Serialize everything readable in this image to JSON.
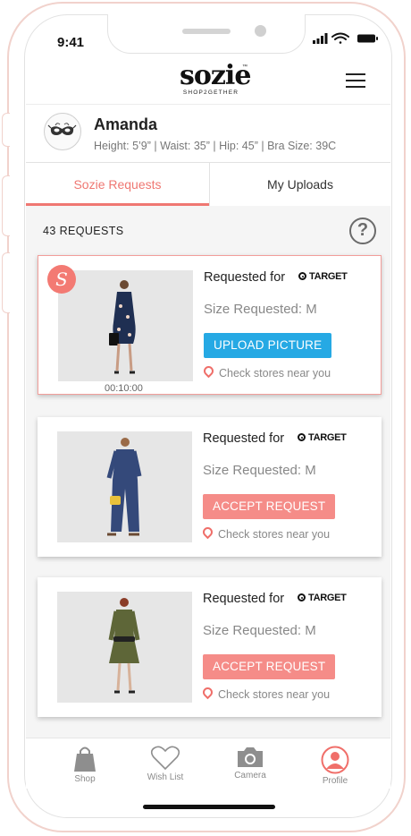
{
  "status_bar": {
    "time": "9:41"
  },
  "header": {
    "logo_main": "sozie",
    "logo_tm": "™",
    "logo_sub": "SHOP2GETHER",
    "menu_icon": "hamburger-menu-icon"
  },
  "profile": {
    "name": "Amanda",
    "stats": "Height: 5’9”  |  Waist: 35”  |  Hip: 45”  |  Bra Size: 39C",
    "avatar_icon": "masquerade-mask-icon"
  },
  "tabs": [
    {
      "label": "Sozie Requests",
      "active": true
    },
    {
      "label": "My Uploads",
      "active": false
    }
  ],
  "requests_count": "43 REQUESTS",
  "help_label": "?",
  "cards": [
    {
      "badge": "S",
      "timer": "00:10:00",
      "requested_for": "Requested for",
      "brand": "TARGET",
      "size": "Size Requested: M",
      "action": "UPLOAD PICTURE",
      "stores": "Check stores near you",
      "image": "floral-wrap-dress-model"
    },
    {
      "requested_for": "Requested for",
      "brand": "TARGET",
      "size": "Size Requested: M",
      "action": "ACCEPT REQUEST",
      "stores": "Check stores near you",
      "image": "denim-jumpsuit-model"
    },
    {
      "requested_for": "Requested for",
      "brand": "TARGET",
      "size": "Size Requested: M",
      "action": "ACCEPT REQUEST",
      "stores": "Check stores near you",
      "image": "olive-dress-model"
    }
  ],
  "bottom_nav": [
    {
      "label": "Shop",
      "icon": "shopping-bag-icon"
    },
    {
      "label": "Wish List",
      "icon": "heart-icon"
    },
    {
      "label": "Camera",
      "icon": "camera-icon"
    },
    {
      "label": "Profile",
      "icon": "profile-icon",
      "active": true
    }
  ],
  "colors": {
    "accent": "#ef7772",
    "upload_button": "#26a9e4",
    "accept_button": "#f58c88",
    "phone_frame": "#f1d2cc"
  }
}
